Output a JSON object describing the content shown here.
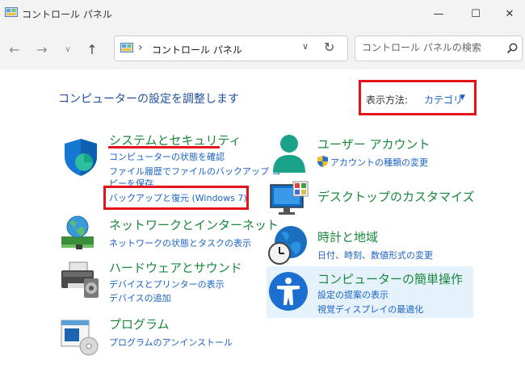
{
  "window": {
    "title": "コントロール パネル",
    "minimize_glyph": "—",
    "maximize_glyph": "☐",
    "close_glyph": "✕"
  },
  "nav": {
    "back_glyph": "←",
    "forward_glyph": "→",
    "recent_glyph": "∨",
    "up_glyph": "↑",
    "address_separator": "›",
    "address_text": "コントロール パネル",
    "address_dropdown_glyph": "∨",
    "refresh_glyph": "↻",
    "search_placeholder": "コントロール パネルの検索"
  },
  "heading": "コンピューターの設定を調整します",
  "view_by": {
    "label": "表示方法:",
    "value": "カテゴリ",
    "caret": "▼"
  },
  "categories_left": [
    {
      "title": "システムとセキュリティ",
      "icon": "shield-icon",
      "links": [
        "コンピューターの状態を確認",
        "ファイル履歴でファイルのバックアップ コ",
        "ピーを保存",
        "バックアップと復元 (Windows 7)"
      ]
    },
    {
      "title": "ネットワークとインターネット",
      "icon": "network-globe-icon",
      "links": [
        "ネットワークの状態とタスクの表示"
      ]
    },
    {
      "title": "ハードウェアとサウンド",
      "icon": "printer-icon",
      "links": [
        "デバイスとプリンターの表示",
        "デバイスの追加"
      ]
    },
    {
      "title": "プログラム",
      "icon": "programs-icon",
      "links": [
        "プログラムのアンインストール"
      ]
    }
  ],
  "categories_right": [
    {
      "title": "ユーザー アカウント",
      "icon": "user-icon",
      "links": [
        "アカウントの種類の変更"
      ],
      "link_icon": "uac-shield-icon"
    },
    {
      "title": "デスクトップのカスタマイズ",
      "icon": "monitor-icon",
      "links": []
    },
    {
      "title": "時計と地域",
      "icon": "clock-globe-icon",
      "links": [
        "日付、時刻、数値形式の変更"
      ]
    },
    {
      "title": "コンピューターの簡単操作",
      "icon": "accessibility-icon",
      "links": [
        "設定の提案の表示",
        "視覚ディスプレイの最適化"
      ]
    }
  ],
  "colors": {
    "category_title": "#19883b",
    "link": "#1a63c6",
    "heading": "#1f4f9c",
    "annotation_red": "#e3121b",
    "hover_bg": "#e5f1fb"
  }
}
